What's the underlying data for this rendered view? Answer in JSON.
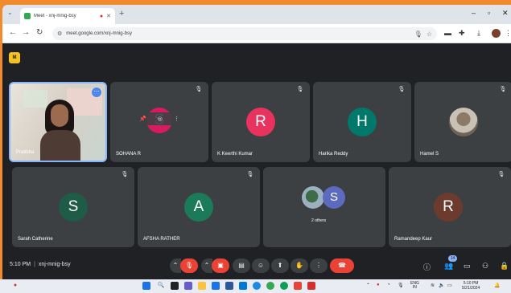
{
  "browser": {
    "tab_title": "Meet - xnj-mnig-bsy",
    "url": "meet.google.com/xnj-mnig-bsy",
    "new_tab": "+",
    "minimize": "–",
    "maximize": "▫",
    "close": "✕"
  },
  "meet": {
    "logo_text": "M",
    "tiles": [
      {
        "name": "Pratibha",
        "type": "video"
      },
      {
        "name": "SOHANA R",
        "initial": "S",
        "color": "#d81b60"
      },
      {
        "name": "K Keerthi Kumar",
        "initial": "R",
        "color": "#e8335f"
      },
      {
        "name": "Harika Reddy",
        "initial": "H",
        "color": "#00796b"
      },
      {
        "name": "Hamel S",
        "type": "photo"
      },
      {
        "name": "Sarah Catherine",
        "initial": "S",
        "color": "#1e5c47"
      },
      {
        "name": "AFSHA RATHER",
        "initial": "A",
        "color": "#1a7a5a"
      },
      {
        "name": "2 others",
        "initial": "S",
        "color": "#5c6bc0"
      },
      {
        "name": "Ramandeep Kaur",
        "initial": "R",
        "color": "#6d3b2e"
      }
    ],
    "time": "5:10 PM",
    "meeting_code": "xnj-mnig-bsy",
    "participant_count": "14"
  },
  "taskbar": {
    "lang": "ENG",
    "region": "IN",
    "time": "5:10 PM",
    "date": "5/21/2024"
  },
  "colors": {
    "accent_blue": "#8ab4f8",
    "danger_red": "#ea4335",
    "meet_bg": "#202124",
    "tile_bg": "#3c4043"
  }
}
